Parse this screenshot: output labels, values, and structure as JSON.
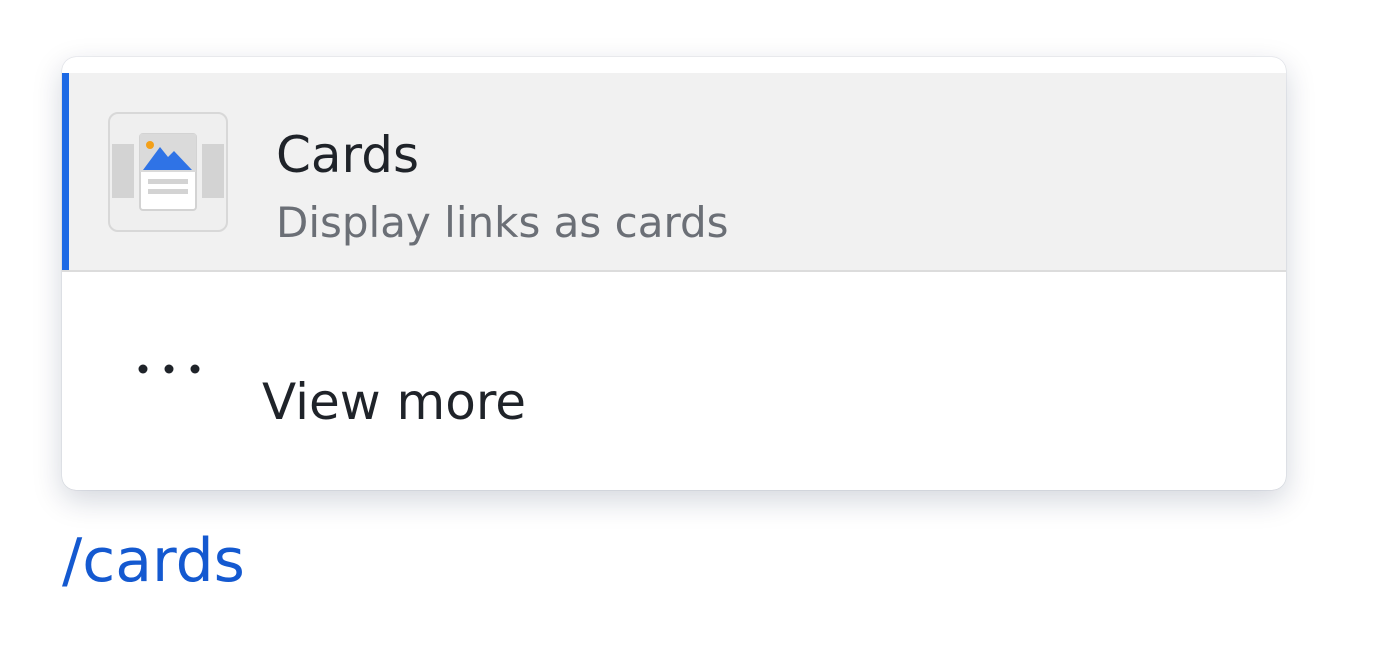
{
  "menu": {
    "selected_item": {
      "title": "Cards",
      "description": "Display links as cards",
      "icon": "cards-thumbnail-icon",
      "accent_color": "#1d6ae5"
    },
    "more_item": {
      "label": "View more",
      "icon": "more-horizontal-icon"
    }
  },
  "editor": {
    "command_text": "/cards",
    "command_color": "#1459d0"
  }
}
